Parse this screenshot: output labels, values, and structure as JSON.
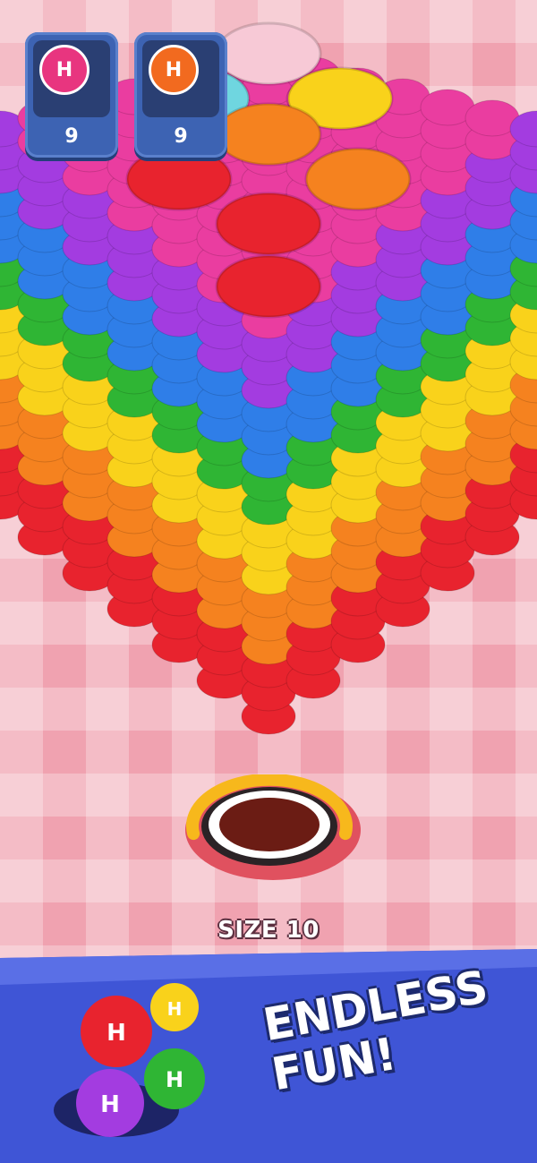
{
  "counters": [
    {
      "icon": "h-candy-icon",
      "letter": "H",
      "color": "#e8357f",
      "count": "9"
    },
    {
      "icon": "h-candy-icon",
      "letter": "H",
      "color": "#f26a1f",
      "count": "9"
    }
  ],
  "hole": {
    "size_label": "SIZE 10",
    "progress": 0.55
  },
  "banner": {
    "line1": "ENDLESS",
    "line2": "FUN!"
  },
  "candy_colors": [
    "#e8232e",
    "#f5821f",
    "#f9d21b",
    "#2fb534",
    "#2f7ee8",
    "#a33ce0",
    "#ea3da0"
  ]
}
